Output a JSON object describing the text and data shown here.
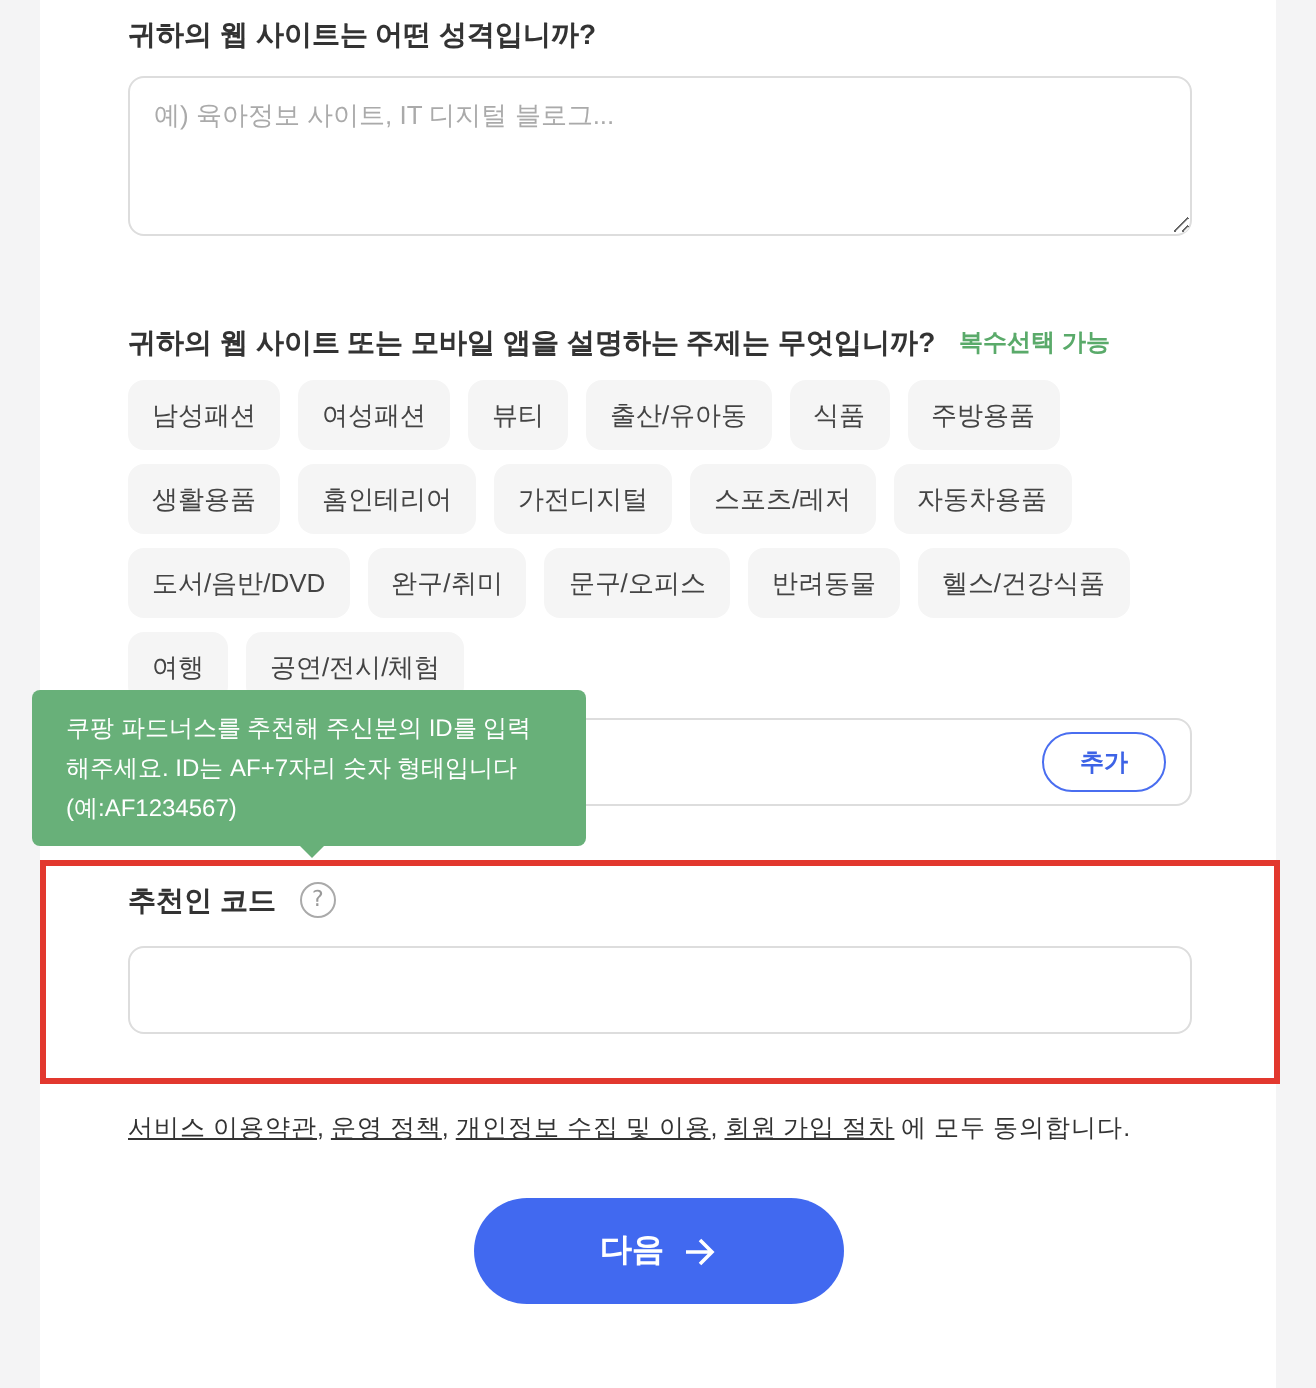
{
  "site_type": {
    "question": "귀하의 웹 사이트는 어떤 성격입니까?",
    "placeholder": "예) 육아정보 사이트, IT 디지털 블로그..."
  },
  "topics": {
    "question": "귀하의 웹 사이트 또는 모바일 앱을 설명하는 주제는 무엇입니까?",
    "note": "복수선택 가능",
    "tags": [
      {
        "label": "남성패션",
        "selected": false
      },
      {
        "label": "여성패션",
        "selected": false
      },
      {
        "label": "뷰티",
        "selected": false
      },
      {
        "label": "출산/유아동",
        "selected": false
      },
      {
        "label": "식품",
        "selected": false
      },
      {
        "label": "주방용품",
        "selected": false
      },
      {
        "label": "생활용품",
        "selected": false
      },
      {
        "label": "홈인테리어",
        "selected": false
      },
      {
        "label": "가전디지털",
        "selected": false
      },
      {
        "label": "스포츠/레저",
        "selected": false
      },
      {
        "label": "자동차용품",
        "selected": false
      },
      {
        "label": "도서/음반/DVD",
        "selected": false
      },
      {
        "label": "완구/취미",
        "selected": false
      },
      {
        "label": "문구/오피스",
        "selected": false
      },
      {
        "label": "반려동물",
        "selected": false
      },
      {
        "label": "헬스/건강식품",
        "selected": false
      },
      {
        "label": "여행",
        "selected": false
      },
      {
        "label": "공연/전시/체험",
        "selected": false
      }
    ],
    "add_button": "추가"
  },
  "tooltip": "쿠팡 파드너스를 추천해 주신분의 ID를 입력해주세요. ID는 AF+7자리 숫자 형태입니다 (예:AF1234567)",
  "referral": {
    "label": "추천인 코드",
    "help_icon": "?"
  },
  "agreement": [
    {
      "link": "서비스 이용약관",
      "after": ", "
    },
    {
      "link": "운영 정책",
      "after": ", "
    },
    {
      "link": "개인정보 수집 및 이용",
      "after": ", "
    },
    {
      "link": "회원 가입 절차",
      "after": " 에 모두 동의합니다."
    }
  ],
  "next_button": "다음"
}
